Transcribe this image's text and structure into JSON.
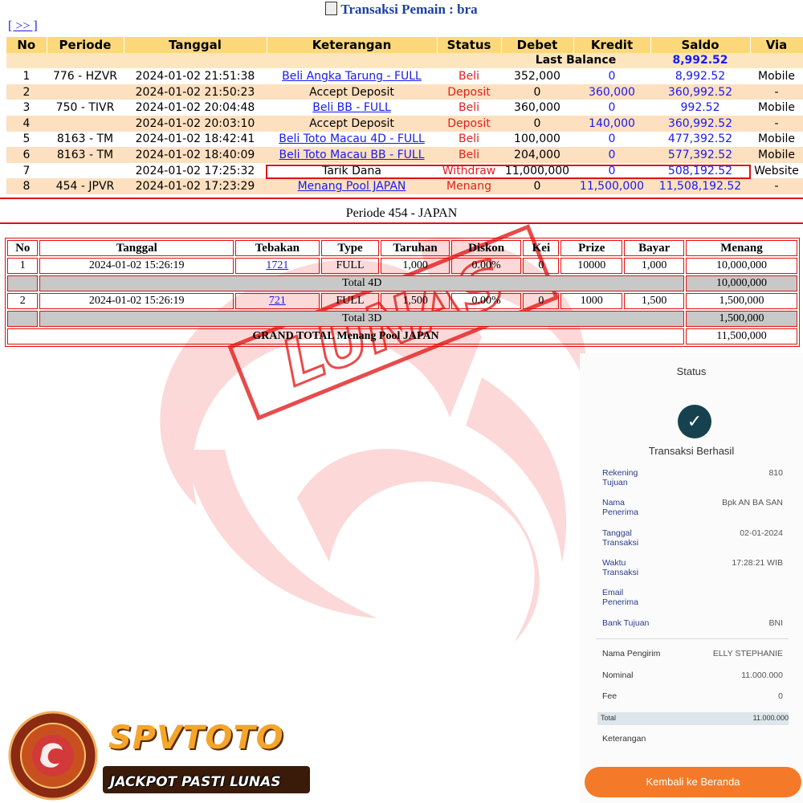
{
  "title": "Transaksi   Pemain : bra",
  "nav": "[ >> ]",
  "transactions": {
    "headers": [
      "No",
      "Periode",
      "Tanggal",
      "Keterangan",
      "Status",
      "Debet",
      "Kredit",
      "Saldo",
      "Via"
    ],
    "last_balance_label": "Last Balance",
    "last_balance_value": "8,992.52",
    "rows": [
      {
        "no": "1",
        "periode": "776 - HZVR",
        "tanggal": "2024-01-02 21:51:38",
        "keterangan": "Beli Angka Tarung - FULL",
        "status": "Beli",
        "debet": "352,000",
        "kredit": "0",
        "saldo": "8,992.52",
        "via": "Mobile"
      },
      {
        "no": "2",
        "periode": "",
        "tanggal": "2024-01-02 21:50:23",
        "keterangan": "Accept Deposit",
        "status": "Deposit",
        "debet": "0",
        "kredit": "360,000",
        "saldo": "360,992.52",
        "via": "-"
      },
      {
        "no": "3",
        "periode": "750 - TIVR",
        "tanggal": "2024-01-02 20:04:48",
        "keterangan": "Beli BB - FULL",
        "status": "Beli",
        "debet": "360,000",
        "kredit": "0",
        "saldo": "992.52",
        "via": "Mobile"
      },
      {
        "no": "4",
        "periode": "",
        "tanggal": "2024-01-02 20:03:10",
        "keterangan": "Accept Deposit",
        "status": "Deposit",
        "debet": "0",
        "kredit": "140,000",
        "saldo": "360,992.52",
        "via": "-"
      },
      {
        "no": "5",
        "periode": "8163 - TM",
        "tanggal": "2024-01-02 18:42:41",
        "keterangan": "Beli Toto Macau 4D - FULL",
        "status": "Beli",
        "debet": "100,000",
        "kredit": "0",
        "saldo": "477,392.52",
        "via": "Mobile"
      },
      {
        "no": "6",
        "periode": "8163 - TM",
        "tanggal": "2024-01-02 18:40:09",
        "keterangan": "Beli Toto Macau BB - FULL",
        "status": "Beli",
        "debet": "204,000",
        "kredit": "0",
        "saldo": "577,392.52",
        "via": "Mobile"
      },
      {
        "no": "7",
        "periode": "",
        "tanggal": "2024-01-02 17:25:32",
        "keterangan": "Tarik Dana",
        "status": "Withdraw",
        "debet": "11,000,000",
        "kredit": "0",
        "saldo": "508,192.52",
        "via": "Website"
      },
      {
        "no": "8",
        "periode": "454 - JPVR",
        "tanggal": "2024-01-02 17:23:29",
        "keterangan": "Menang Pool JAPAN",
        "status": "Menang",
        "debet": "0",
        "kredit": "11,500,000",
        "saldo": "11,508,192.52",
        "via": "-"
      }
    ]
  },
  "periode_title": "Periode 454 - JAPAN",
  "prize_table": {
    "headers": [
      "No",
      "Tanggal",
      "Tebakan",
      "Type",
      "Taruhan",
      "Diskon",
      "Kei",
      "Prize",
      "Bayar",
      "Menang"
    ],
    "row1": {
      "no": "1",
      "tanggal": "2024-01-02 15:26:19",
      "tebakan": "1721",
      "type": "FULL",
      "taruhan": "1,000",
      "diskon": "0.00%",
      "kei": "0",
      "prize": "10000",
      "bayar": "1,000",
      "menang": "10,000,000"
    },
    "total4d_label": "Total 4D",
    "total4d_value": "10,000,000",
    "row2": {
      "no": "2",
      "tanggal": "2024-01-02 15:26:19",
      "tebakan": "721",
      "type": "FULL",
      "taruhan": "1,500",
      "diskon": "0.00%",
      "kei": "0",
      "prize": "1000",
      "bayar": "1,500",
      "menang": "1,500,000"
    },
    "total3d_label": "Total 3D",
    "total3d_value": "1,500,000",
    "grand_label": "GRAND TOTAL  Menang Pool JAPAN",
    "grand_value": "11,500,000"
  },
  "watermark_text": "LUNAS",
  "receipt": {
    "header": "Status",
    "title": "Transaksi Berhasil",
    "rows": [
      {
        "k": "Rekening Tujuan",
        "v": "810"
      },
      {
        "k": "Nama Penerima",
        "v": "Bpk AN       BA SAN"
      },
      {
        "k": "Tanggal Transaksi",
        "v": "02-01-2024"
      },
      {
        "k": "Waktu Transaksi",
        "v": "17:28:21 WIB"
      },
      {
        "k": "Email Penerima",
        "v": ""
      },
      {
        "k": "Bank Tujuan",
        "v": "BNI"
      }
    ],
    "rows2": [
      {
        "k": "Nama Pengirim",
        "v": "ELLY STEPHANIE"
      },
      {
        "k": "Nominal",
        "v": "11.000.000"
      },
      {
        "k": "Fee",
        "v": "0"
      }
    ],
    "total_label": "Total",
    "total_value": "11.000.000",
    "keterangan_label": "Keterangan",
    "button": "Kembali ke Beranda"
  },
  "brand": {
    "name": "SPVTOTO",
    "slogan": "JACKPOT PASTI LUNAS"
  },
  "colors": {
    "header_bg": "#fdd87a",
    "row_alt_bg": "#fde0bf",
    "link": "#1a1aee",
    "status_red": "#e02020",
    "highlight_border": "#e01010",
    "check_bg": "#16424f",
    "button_bg": "#f47a2a",
    "brand_gold": "#f4a52a"
  }
}
